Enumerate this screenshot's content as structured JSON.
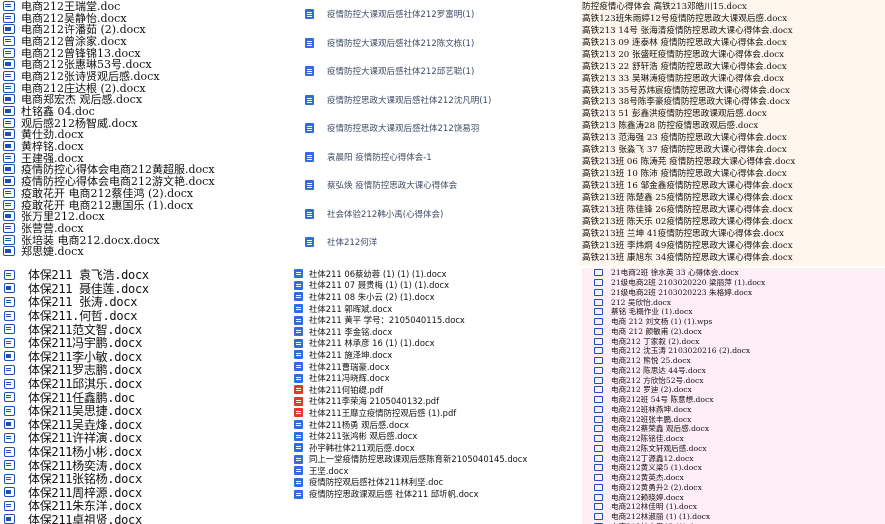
{
  "panels": {
    "p1": [
      "电商212王瑞堂.doc",
      "电商212吴静怡.docx",
      "电商212许潘茹 (2).docx",
      "电商212曾涂家.docx",
      "电商212曾锋锦13.docx",
      "电商212张惠琳53号.docx",
      "电商212张诗贤观后感.docx",
      "电商212庄达根 (2).docx",
      "电商郑宏杰 观后感.docx",
      "杜铭鑫 04.doc",
      "观后感212杨智威.docx",
      "黄仕劲.docx",
      "黄梓铭.docx",
      "王建强.docx",
      "疫情防控心得体会电商212黄超服.docx",
      "疫情防控心得体会电商212游文艳.docx",
      "疫敢花开 电商212蔡佳鸿 (2).docx",
      "疫敢花开 电商212惠国乐 (1).docx",
      "张万里212.docx",
      "张营营.docx",
      "张培装 电商212.docx.docx",
      "郑思婕.docx"
    ],
    "p2": [
      "疫情防控大课观后感社体212罗富明(1)",
      "疫情防控大课观后感社体212陈文栋(1)",
      "疫情防控大课观后感社体212邱艺聪(1)",
      "疫情防控思政大课观后感社体212沈凡明(1)",
      "疫情防控思政大课观后感社体212饶易羽",
      "袁晨阳 疫情防控心得体会-1",
      "蔡弘焕 疫情防控思政大课心得体会",
      "社会体验212韩小禹(心得体会)",
      "社体212何洋",
      "社体212吕志浩"
    ],
    "p3": [
      "防控疫情心得体会 高铁213邓皓川15.docx",
      "高铁123班朱雨婷12号疫情防控思政大课观后感.docx",
      "高铁213  14号  张海清疫情防控思政大课心得体会.docx",
      "高铁213 09 连泰林 疫情防控思政大课心得体会.docx",
      "高铁213 20  张盛旺疫情防控思政大课心得体会.docx",
      "高铁213 22 舒轩浩 疫情防控思政大课心得体会.docx",
      "高铁213 33 吴琳涛疫情防控思政大课心得体会.docx",
      "高铁213 35号苏炜宸疫情防控思政大课心得体会.docx",
      "高铁213 38号陈李豪疫情防控思政大课心得体会.docx",
      "高铁213 51 彭鑫洪疫情防控思政课观后感.docx",
      "高铁213 陈鑫涛28 防控疫情思政观后感.docx",
      "高铁213 范海强 23 疫情防控思政大课心得体会.docx",
      "高铁213 张淼飞 37 疫情防控思政大课心得体会.docx",
      "高铁213班 06 陈涛芫 疫情防控思政大课心得体会.docx",
      "高铁213班 10 陈沛 疫情防控思政大课心得体会.docx",
      "高铁213班 16 邹金鑫疫情防控思政大课心得体会.docx",
      "高铁213班 陈楚鑫 25疫情防控思政大课心得体会.docx",
      "高铁213班 陈佳锋 26疫情防控思政大课心得体会.docx",
      "高铁213班 陈天乐 02疫情防控思政大课心得体会.docx",
      "高铁213班 兰坤 41疫情防控思政大课心得体会.docx",
      "高铁213班 李炜炯 49疫情防控思政大课心得体会.docx",
      "高铁213班 康旭东 34疫情防控思政大课心得体会.docx"
    ],
    "p4": [
      "体保211  袁飞浩.docx",
      "体保211  聂佳莲.docx",
      "体保211  张涛.docx",
      "体保211.何哲.docx",
      "体保211范文智.docx",
      "体保211冯宇鹏.docx",
      "体保211李小敏.docx",
      "体保211罗志鹏.docx",
      "体保211邱淇乐.docx",
      "体保211任鑫鹏.doc",
      "体保211吴思捷.docx",
      "体保211吴垚烽.docx",
      "体保211许祥演.docx",
      "体保211杨小彬.docx",
      "体保211杨奕涛.docx",
      "体保211张铭杨.docx",
      "体保211周梓源.docx",
      "体保211朱东洋.docx",
      "体保211卓祖贤.docx"
    ],
    "p5": [
      {
        "t": "社体211 06蔡幼蓉 (1) (1) (1).docx",
        "pdf": false
      },
      {
        "t": "社体211 07 聂贵梅 (1) (1) (1).docx",
        "pdf": false
      },
      {
        "t": "社体211 08 朱小云 (2) (1).docx",
        "pdf": false
      },
      {
        "t": "社体211 郭晖斌.docx",
        "pdf": false
      },
      {
        "t": "社体211 黄平 学号：2105040115.docx",
        "pdf": false
      },
      {
        "t": "社体211 李金铭.docx",
        "pdf": false
      },
      {
        "t": "社体211 林承彦 16 (1) (1).docx",
        "pdf": false
      },
      {
        "t": "社体211 施泽坤.docx",
        "pdf": false
      },
      {
        "t": "社体211曹瑞豪.docx",
        "pdf": false
      },
      {
        "t": "社体211冯晓辉.docx",
        "pdf": false
      },
      {
        "t": "社体211何铂缇.pdf",
        "pdf": true
      },
      {
        "t": "社体211李荣海 2105040132.pdf",
        "pdf": true
      },
      {
        "t": "社体211王靡立疫情防控观后感 (1).pdf",
        "pdf": true
      },
      {
        "t": "社体211杨勇   观后感.docx",
        "pdf": false
      },
      {
        "t": "社体211张鸿彬 观后感.docx",
        "pdf": false
      },
      {
        "t": "孙宇韩社体211观后感.docx",
        "pdf": false
      },
      {
        "t": "同上一堂疫情防控思政课观后感陈育新2105040145.docx",
        "pdf": false
      },
      {
        "t": "王坚.docx",
        "pdf": false
      },
      {
        "t": "疫情防控观后感社体211林利坚.doc",
        "pdf": false
      },
      {
        "t": "疫情防控思政课观后感 社体211 邱圻帆.docx",
        "pdf": false
      }
    ],
    "p6": [
      "21电商2班 徐水英 33  心得体会.docx",
      "21级电商2班  2103020220  梁丽萍 (1).docx",
      "21级电商2班  2103020223  朱格婷.docx",
      "212  吴欣怡.docx",
      "蔡铭 毛概作业 (1).docx",
      "电商  212  刘文杨 (1) (1).wps",
      "电商 212 颜敏甫 (2).docx",
      "电商212  丁家叙 (2).docx",
      "电商212  沈玉涛  2103020216 (2).docx",
      "电商212  熊悦 25.docx",
      "电商212 陈思达 44号.docx",
      "电商212 方欣怡52号.docx",
      "电商212 罗迪 (2).docx",
      "电商212班 54号 陈意想.docx",
      "电商212班林燕坤.docx",
      "电商212班张丰鹏.docx",
      "电商212蔡荣鑫 观后感.docx",
      "电商212陈铭佳.docx",
      "电商212陈文轩观后感.docx",
      "电商212丁源鑫12.docx",
      "电商212黄义梁5 (1).docx",
      "电商212黄英杰.docx",
      "电商212黄勇升2 (2).docx",
      "电商212赖晓婷.docx",
      "电商212林佳明 (1).docx",
      "电商212林淑丽 (1) (1).docx",
      "电商212林志恩43 (1).docx"
    ]
  }
}
